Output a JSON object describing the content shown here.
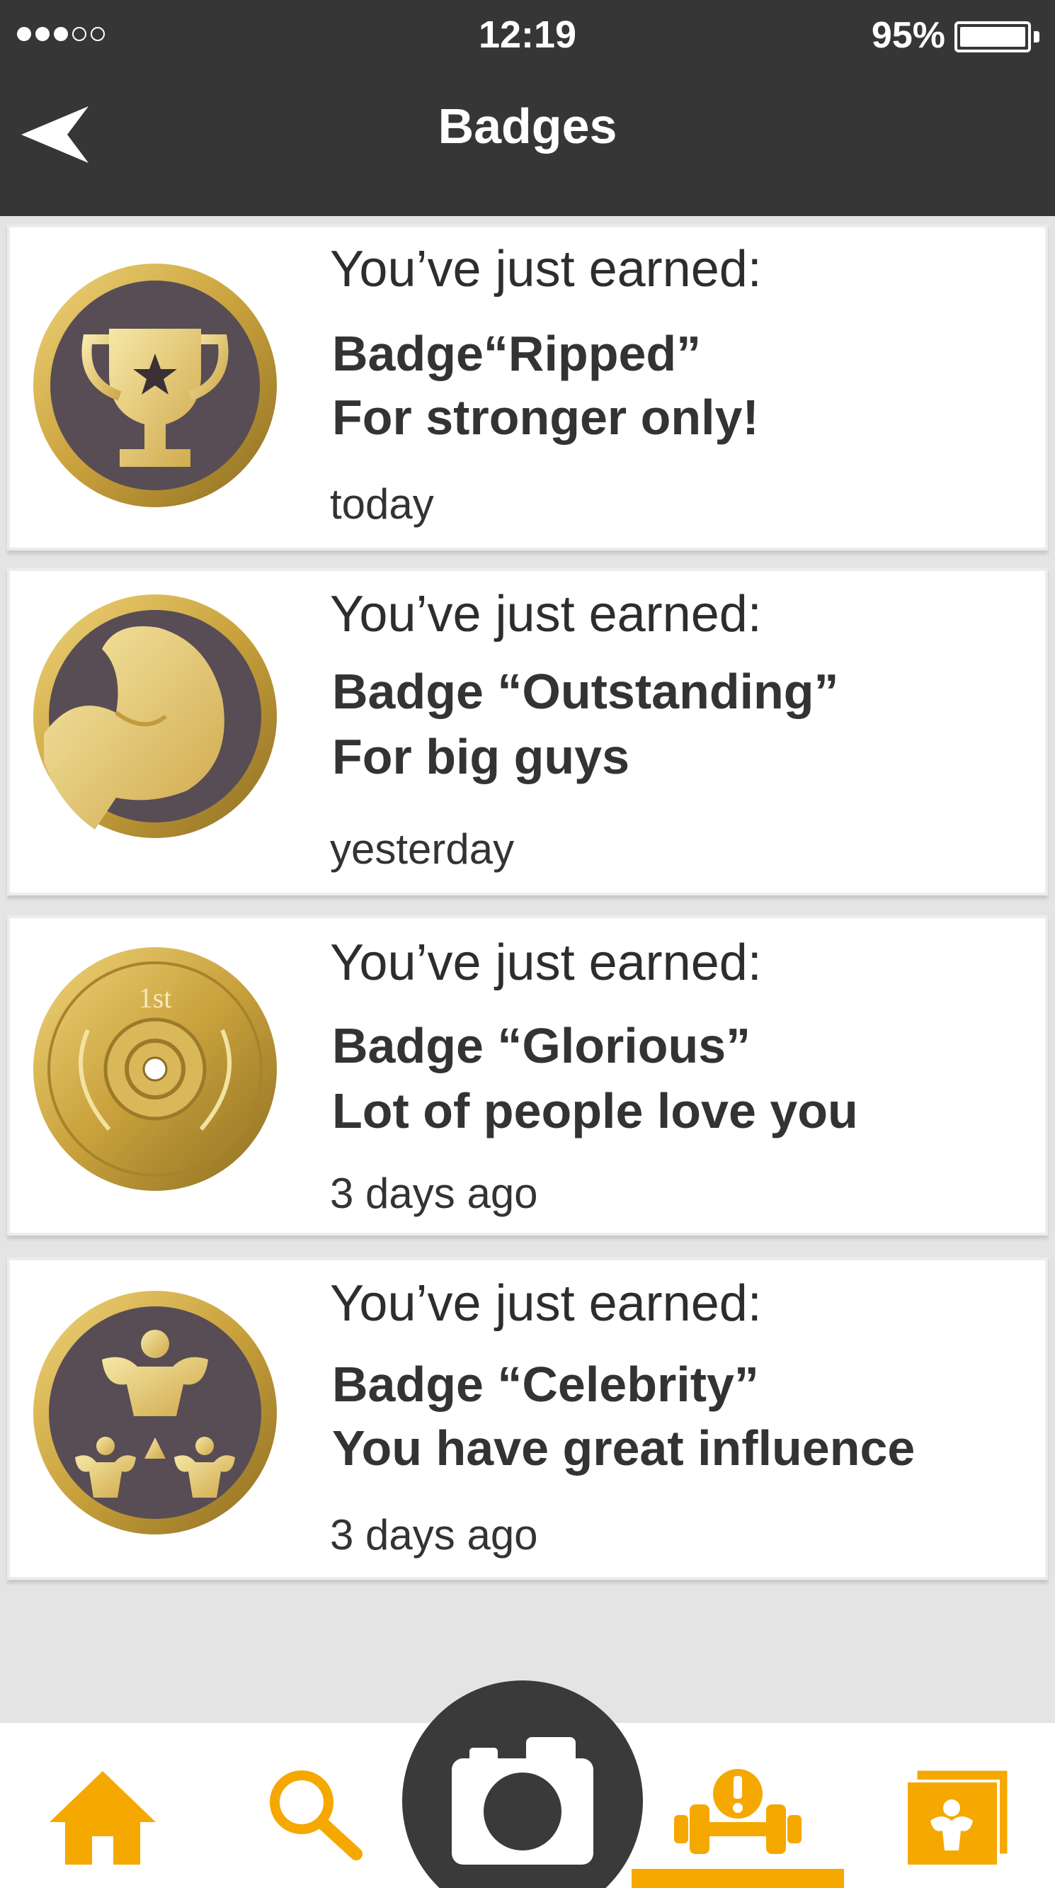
{
  "status_bar": {
    "time": "12:19",
    "battery": "95%"
  },
  "header": {
    "title": "Badges"
  },
  "badges": [
    {
      "earned_label": "You’ve just earned:",
      "name": "Badge“Ripped”",
      "description": "For stronger only!",
      "date": "today",
      "icon": "trophy-medal-icon"
    },
    {
      "earned_label": "You’ve just earned:",
      "name": "Badge “Outstanding”",
      "description": "For big guys",
      "date": "yesterday",
      "icon": "flexed-arm-medal-icon"
    },
    {
      "earned_label": "You’ve just earned:",
      "name": "Badge “Glorious”",
      "description": "Lot of people love you",
      "date": "3 days ago",
      "icon": "first-place-plate-medal-icon",
      "medal_text": "1st"
    },
    {
      "earned_label": "You’ve just earned:",
      "name": "Badge “Celebrity”",
      "description": "You have great influence",
      "date": "3 days ago",
      "icon": "bodybuilders-medal-icon"
    }
  ],
  "tabbar": {
    "items": [
      "home-icon",
      "search-icon",
      "camera-icon",
      "dumbbell-alert-icon",
      "photo-gallery-icon"
    ],
    "active": "dumbbell-alert-icon"
  },
  "colors": {
    "header": "#363636",
    "accent": "#f5a800",
    "gold": "#d7b24a",
    "medal_dark": "#5a4f55"
  }
}
